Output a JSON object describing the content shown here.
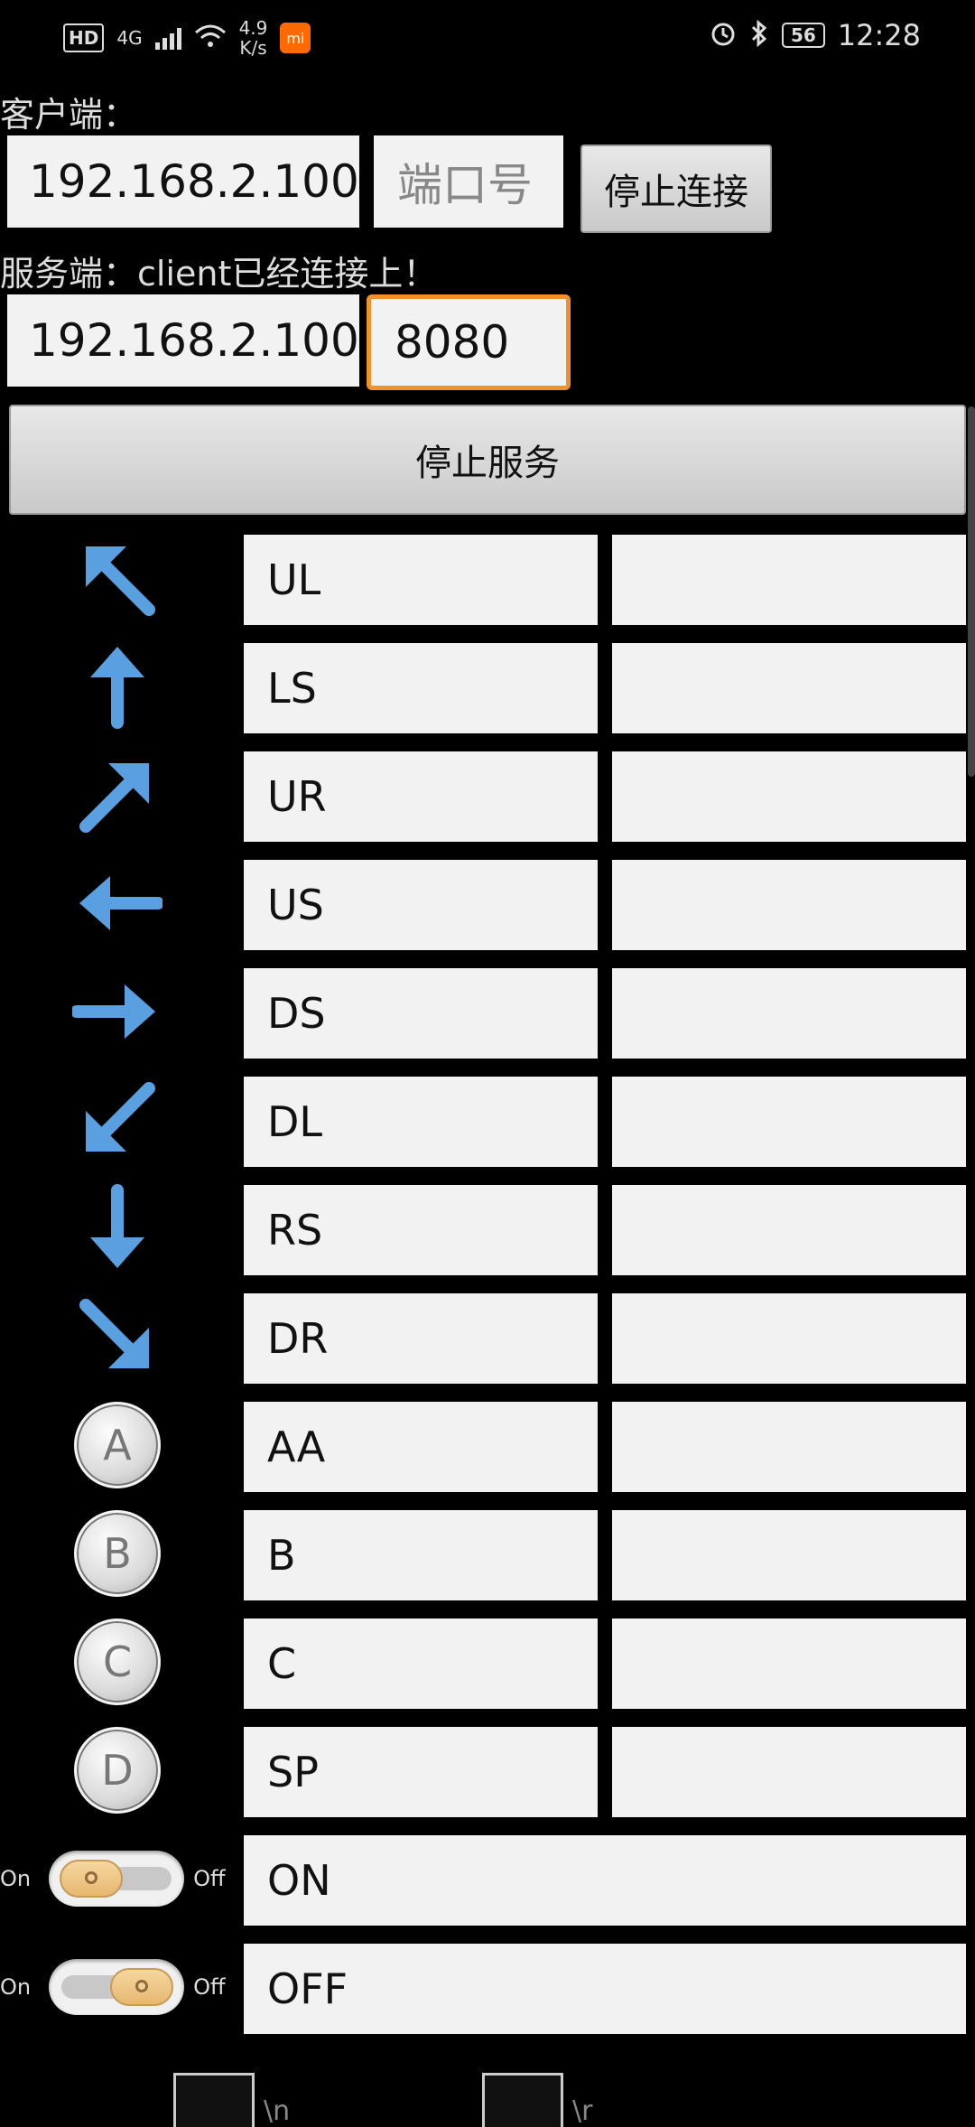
{
  "status_bar": {
    "hd": "HD",
    "network": "4G",
    "speed_value": "4.9",
    "speed_unit": "K/s",
    "app_badge": "mi",
    "battery": "56",
    "time": "12:28",
    "icons": [
      "signal-icon",
      "wifi-icon",
      "alarm-icon",
      "bluetooth-icon",
      "battery-icon"
    ]
  },
  "client": {
    "label": "客户端：",
    "ip": "192.168.2.100",
    "port_placeholder": "端口号",
    "stop_button": "停止连接"
  },
  "server": {
    "label": "服务端：client已经连接上！",
    "ip": "192.168.2.100",
    "port": "8080",
    "stop_button": "停止服务"
  },
  "rows": [
    {
      "icon": "arrow-up-left-icon",
      "value": "UL"
    },
    {
      "icon": "arrow-up-icon",
      "value": "LS"
    },
    {
      "icon": "arrow-up-right-icon",
      "value": "UR"
    },
    {
      "icon": "arrow-left-icon",
      "value": "US"
    },
    {
      "icon": "arrow-right-icon",
      "value": "DS"
    },
    {
      "icon": "arrow-down-left-icon",
      "value": "DL"
    },
    {
      "icon": "arrow-down-icon",
      "value": "RS"
    },
    {
      "icon": "arrow-down-right-icon",
      "value": "DR"
    },
    {
      "icon": "button-a-icon",
      "letter": "A",
      "value": "AA"
    },
    {
      "icon": "button-b-icon",
      "letter": "B",
      "value": "B"
    },
    {
      "icon": "button-c-icon",
      "letter": "C",
      "value": "C"
    },
    {
      "icon": "button-d-icon",
      "letter": "D",
      "value": "SP"
    }
  ],
  "toggles": [
    {
      "on_label": "On",
      "off_label": "Off",
      "state": "on",
      "value": "ON"
    },
    {
      "on_label": "On",
      "off_label": "Off",
      "state": "off",
      "value": "OFF"
    }
  ],
  "bottom": {
    "left_text": "\\n",
    "right_text": "\\r"
  },
  "colors": {
    "focus": "#f0912b",
    "arrow": "#5aa0e0",
    "background": "#000000",
    "field": "#f2f2f2"
  }
}
